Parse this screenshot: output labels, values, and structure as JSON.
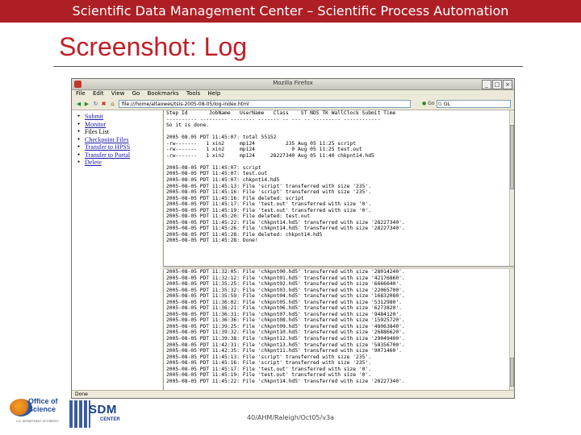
{
  "header": {
    "banner": "Scientific Data Management Center – Scientific Process Automation",
    "slide_title": "Screenshot: Log"
  },
  "browser": {
    "window_title": "Mozilla Firefox",
    "menu": [
      "File",
      "Edit",
      "View",
      "Go",
      "Bookmarks",
      "Tools",
      "Help"
    ],
    "url": "file:///home/altaowes/tsis-2005-08-05/log-index.html",
    "go_label": "Go",
    "search_value": "GL",
    "status": "Done"
  },
  "nav_links": [
    {
      "label": "Submit",
      "link": true
    },
    {
      "label": "Monitor",
      "link": true
    },
    {
      "label": "Files List",
      "link": false
    },
    {
      "label": "Checkpoint Files",
      "link": true
    },
    {
      "label": "Transfer to HPSS",
      "link": true
    },
    {
      "label": "Transfer to Portal",
      "link": true
    },
    {
      "label": "Delete",
      "link": true
    }
  ],
  "log_top": [
    "Step Id       JobName   UserName   Class    ST NDS TK WallClock Submit Time",
    "---------- --------- -------- ------- -- --- -- --------- ------------",
    "So it is done.",
    "",
    "2005 08.05 PDT 11:45:07: total 55152",
    "-rw-------   1 xin2     mp124          235 Aug 05 11:25 script",
    "-rw-------   1 xin2     mp124            0 Aug 05 11:25 test.out",
    "-rw-------   1 xin2     mp124     28227340 Aug 05 11:40 chkpnt14.hd5",
    "",
    "2005-08-05 PDT 11:45:07: script",
    "2005-08-05 PDT 11:45:07: test.out",
    "2005-08-05 PDT 11:45:07: chkpnt14.hd5",
    "2005-08-05 PDT 11:45:13: File 'script' transferred with size '235'.",
    "2005-08-05 PDT 11:45:16: File 'script' transferred with size '235'.",
    "2005-08-05 PDT 11:45:16: File deleted: script",
    "2005-08-05 PDT 11:45:17: File 'test.out' transferred with size '0'.",
    "2005-08-05 PDT 11:45:19: File 'test.out' transferred with size '0'.",
    "2005-08-05 PDT 11:45:20: File deleted: test.out",
    "2005-08-05 PDT 11:45:22: File 'chkpnt14.hd5' transferred with size '28227340'.",
    "2005-08-05 PDT 11:45:26: File 'chkpnt14.hd5' transferred with size '28227340'.",
    "2005-08-05 PDT 11:45:28: File deleted: chkpnt14.hd5",
    "2005-08-05 PDT 11:45:28: Done!"
  ],
  "log_bottom": [
    "2005-08-05 PDT 11:32:05: File 'chkpnt00.hd5' transferred with size '28014240'.",
    "2005-08-05 PDT 11:32:12: File 'chkpnt01.hd5' transferred with size '42176860'.",
    "2005-08-05 PDT 11:35:25: File 'chkpnt02.hd5' transferred with size '6666640'.",
    "2005-08-05 PDT 11:35:32: File 'chkpnt03.hd5' transferred with size '22065700'.",
    "2005-08-05 PDT 11:35:59: File 'chkpnt04.hd5' transferred with size '16832080'.",
    "2005-08-05 PDT 11:36:02: File 'chkpnt05.hd5' transferred with size '5312980'.",
    "2005-08-05 PDT 11:36:21: File 'chkpnt06.hd5' transferred with size '6273820'.",
    "2005-08-05 PDT 11:36:31: File 'chkpnt07.hd5' transferred with size '9484120'.",
    "2005-08-05 PDT 11:36:36: File 'chkpnt08.hd5' transferred with size '15925720'.",
    "2005-08-05 PDT 11:39:25: File 'chkpnt09.hd5' transferred with size '48063840'.",
    "2005-08-05 PDT 11:39:32: File 'chkpnt10.hd5' transferred with size '26886620'.",
    "2005-08-05 PDT 11:39:38: File 'chkpnt12.hd5' transferred with size '29049400'.",
    "2005-08-05 PDT 11:42:31: File 'chkpnt13.hd5' transferred with size '58356700'.",
    "2005-08-05 PDT 11:42:35: File 'chkpnt11.hd5' transferred with size '9071460'.",
    "2005-08-05 PDT 11:45:13: File 'script' transferred with size '235'.",
    "2005-08-05 PDT 11:45:16: File 'script' transferred with size '235'.",
    "2005-08-05 PDT 11:45:17: File 'test.out' transferred with size '0'.",
    "2005-08-05 PDT 11:45:19: File 'test.out' transferred with size '0'.",
    "2005-08-05 PDT 11:45:22: File 'chkpnt14.hd5' transferred with size '28227340'."
  ],
  "footer": {
    "text": "40/AHM/Raleigh/Oct05/v3a",
    "oos_logo_text": "Office of Science",
    "oos_logo_subtext": "U.S. DEPARTMENT OF ENERGY",
    "sdm_logo_text": "SDM",
    "sdm_logo_subtext": "CENTER"
  },
  "colors": {
    "banner_bg": "#ad1f25",
    "title": "#c01e26",
    "link": "#1a1aa6"
  },
  "icons": [
    "back-icon",
    "forward-icon",
    "reload-icon",
    "stop-icon",
    "home-icon",
    "go-icon",
    "search-icon"
  ]
}
